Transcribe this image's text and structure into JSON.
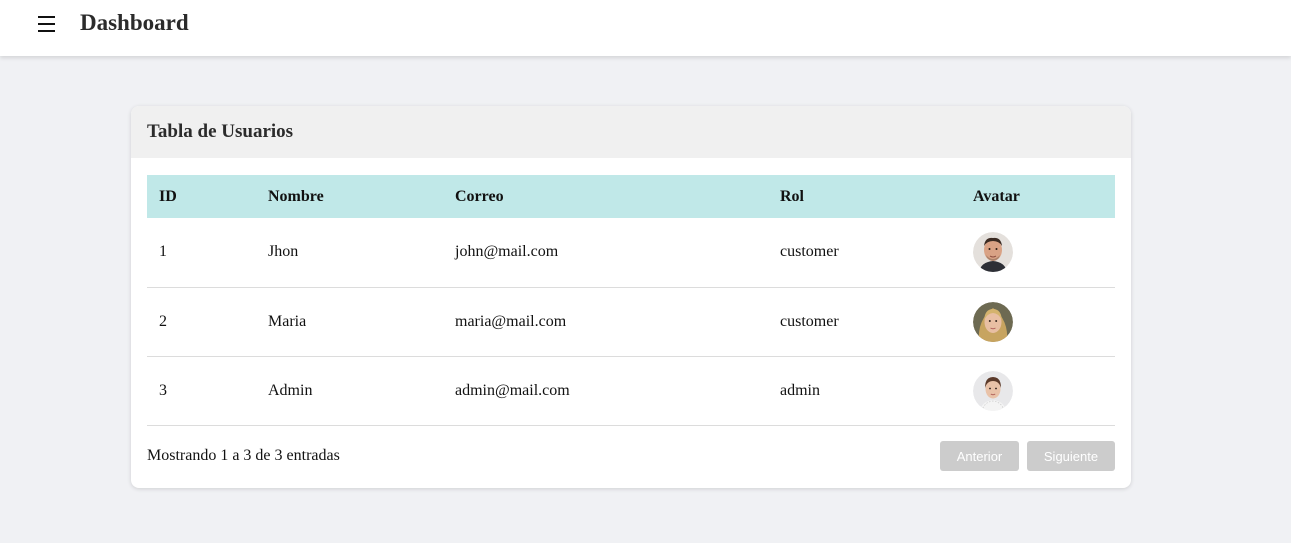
{
  "header": {
    "menu_icon": "hamburger-menu-icon",
    "title": "Dashboard"
  },
  "card": {
    "title": "Tabla de Usuarios"
  },
  "table": {
    "columns": [
      "ID",
      "Nombre",
      "Correo",
      "Rol",
      "Avatar"
    ],
    "rows": [
      {
        "id": "1",
        "name": "Jhon",
        "email": "john@mail.com",
        "role": "customer",
        "avatar": "man-avatar"
      },
      {
        "id": "2",
        "name": "Maria",
        "email": "maria@mail.com",
        "role": "customer",
        "avatar": "woman-blonde-avatar"
      },
      {
        "id": "3",
        "name": "Admin",
        "email": "admin@mail.com",
        "role": "admin",
        "avatar": "woman-dark-hair-avatar"
      }
    ]
  },
  "footer": {
    "info": "Mostrando 1 a 3 de 3 entradas",
    "prev_label": "Anterior",
    "next_label": "Siguiente"
  },
  "colors": {
    "page_background": "#f0f1f4",
    "table_header_background": "#c0e8e8",
    "card_header_background": "#f0f0f0",
    "disabled_button": "#cccccc"
  }
}
